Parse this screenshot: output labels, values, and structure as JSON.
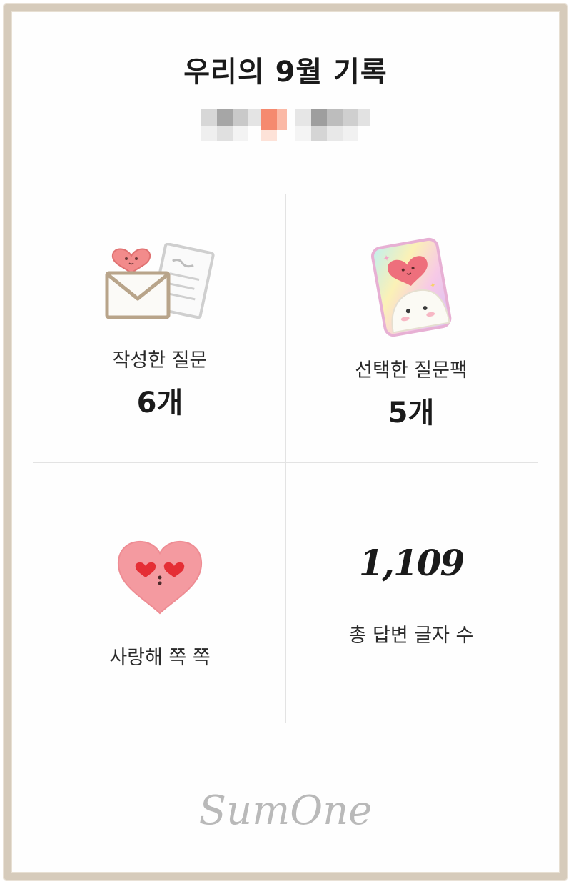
{
  "header": {
    "title": "우리의 9월 기록"
  },
  "stats": {
    "written_questions": {
      "label": "작성한 질문",
      "value": "6개",
      "icon": "letter-envelope-icon"
    },
    "selected_packs": {
      "label": "선택한 질문팩",
      "value": "5개",
      "icon": "question-pack-card-icon"
    },
    "love_kiss": {
      "label": "사랑해 쪽 쪽",
      "icon": "heart-kiss-icon"
    },
    "answer_chars": {
      "value": "1,109",
      "label": "총 답변 글자 수"
    }
  },
  "footer": {
    "brand": "SumOne"
  },
  "colors": {
    "frame": "#d6cbbb",
    "divider": "#e3e3e3",
    "heart": "#f08a8a",
    "accent": "#f4876b"
  }
}
